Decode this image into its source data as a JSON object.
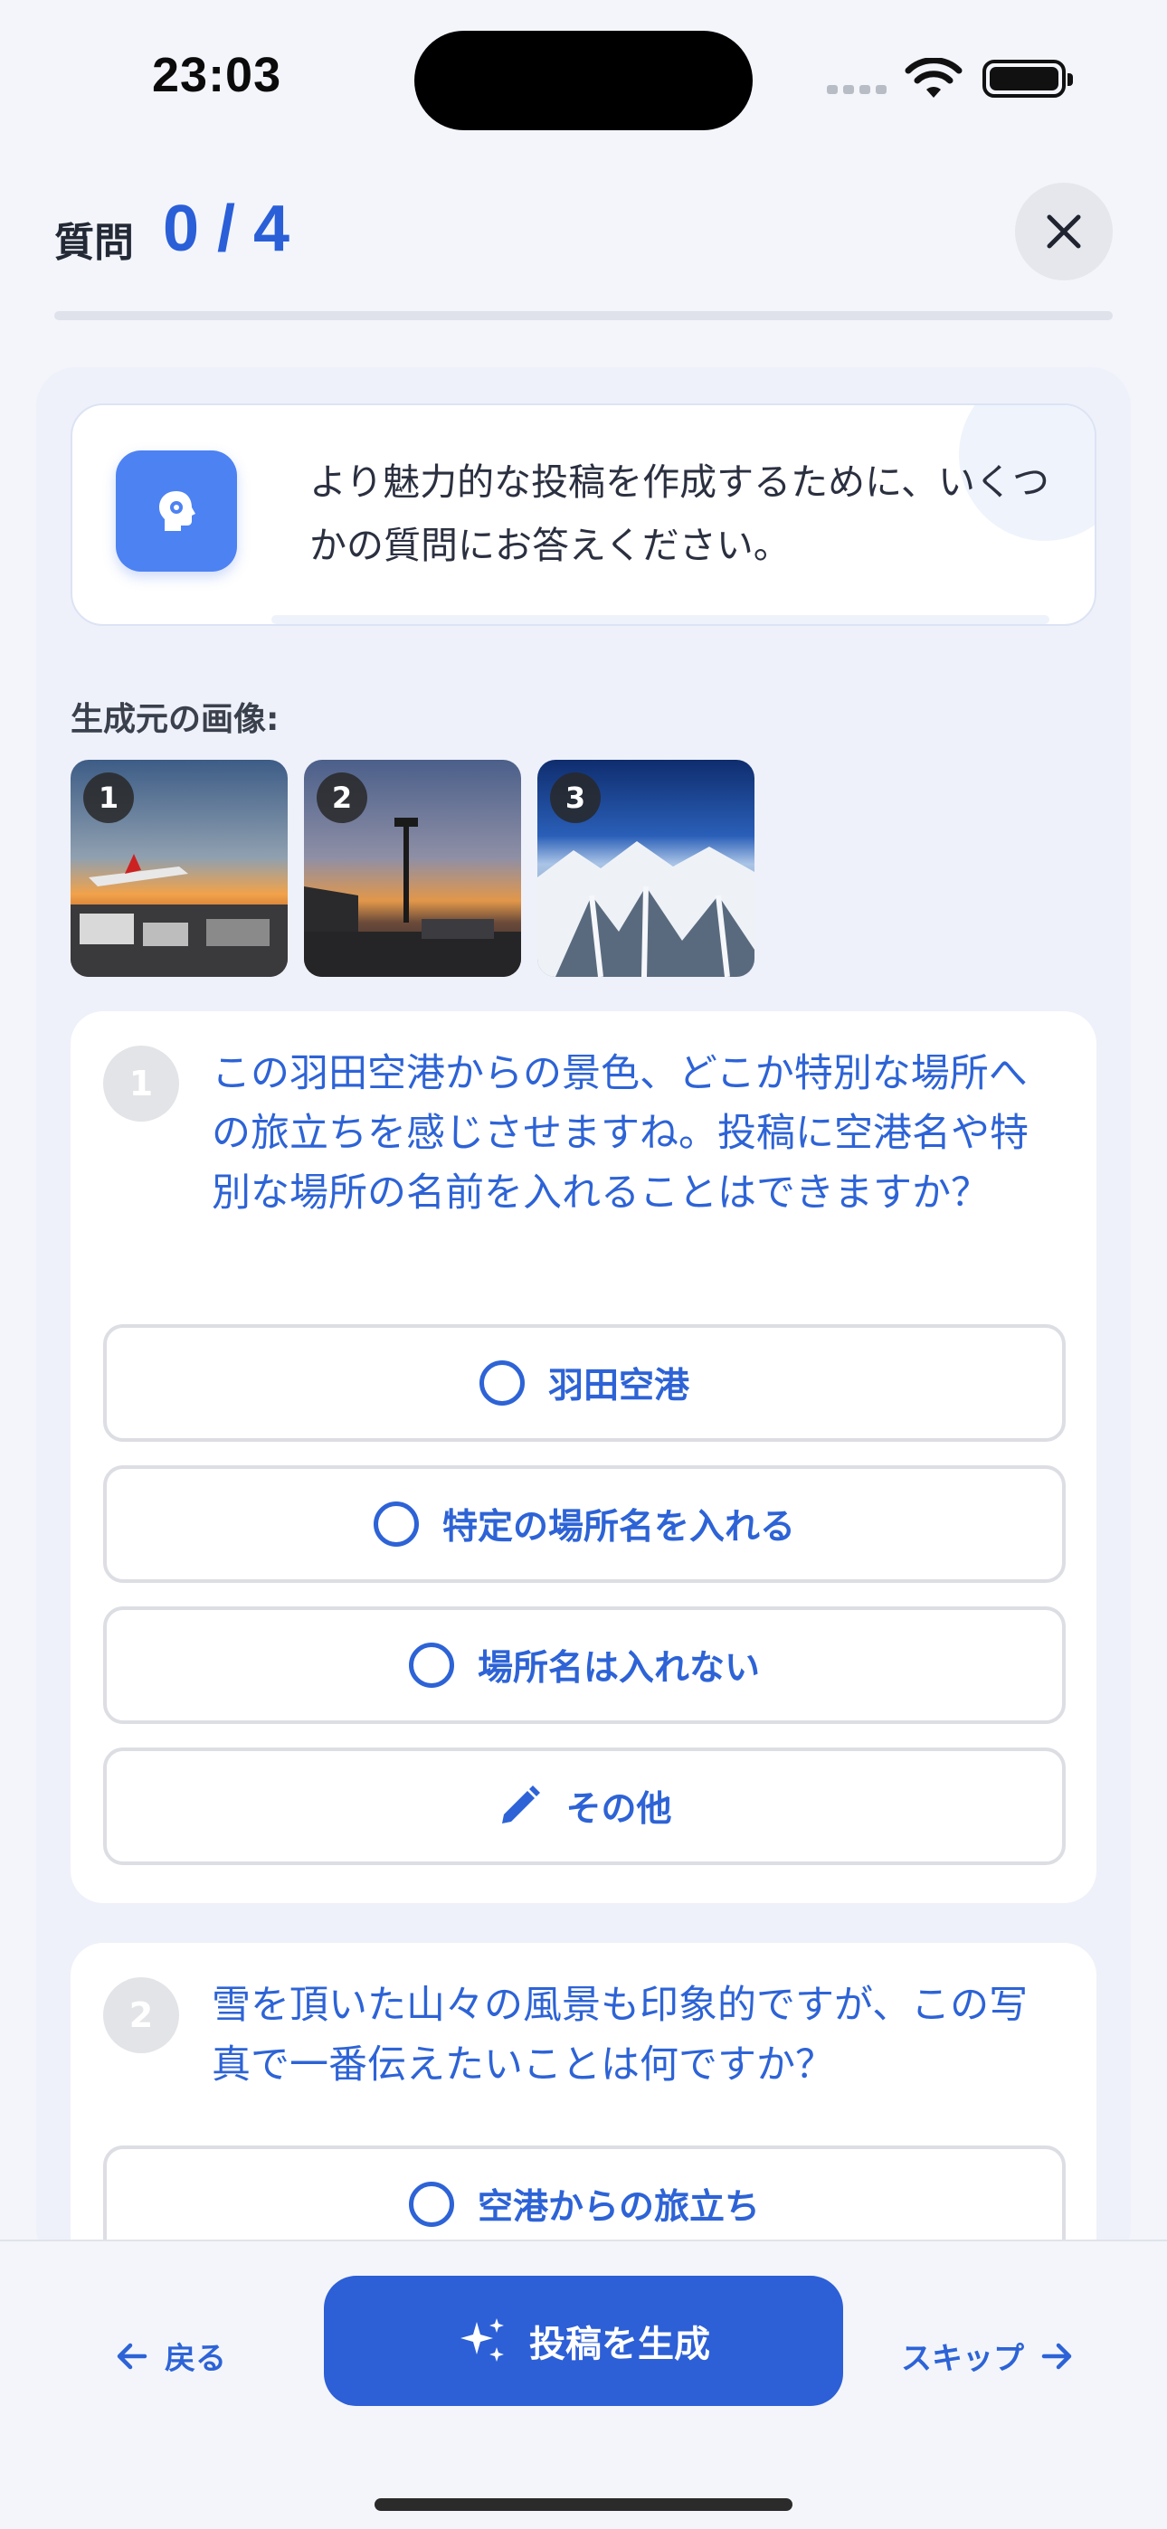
{
  "status_bar": {
    "time": "23:03"
  },
  "header": {
    "label": "質問",
    "progress": "0 / 4",
    "progress_fraction": 0.0
  },
  "intro": {
    "text": "より魅力的な投稿を作成するために、いくつかの質問にお答えください。",
    "icon": "head-gear-icon"
  },
  "source_images": {
    "label": "生成元の画像:",
    "items": [
      {
        "number": "1",
        "subject": "airport-sunset-plane"
      },
      {
        "number": "2",
        "subject": "airport-dusk-light-pole"
      },
      {
        "number": "3",
        "subject": "snowy-mountains-aerial"
      }
    ]
  },
  "questions": [
    {
      "number": "1",
      "text": "この羽田空港からの景色、どこか特別な場所への旅立ちを感じさせますね。投稿に空港名や特別な場所の名前を入れることはできますか？",
      "options": [
        {
          "label": "羽田空港",
          "icon": "radio-icon"
        },
        {
          "label": "特定の場所名を入れる",
          "icon": "radio-icon"
        },
        {
          "label": "場所名は入れない",
          "icon": "radio-icon"
        },
        {
          "label": "その他",
          "icon": "pencil-icon"
        }
      ]
    },
    {
      "number": "2",
      "text": "雪を頂いた山々の風景も印象的ですが、この写真で一番伝えたいことは何ですか？",
      "options": [
        {
          "label": "空港からの旅立ち",
          "icon": "radio-icon"
        }
      ]
    }
  ],
  "footer": {
    "back_label": "戻る",
    "generate_label": "投稿を生成",
    "skip_label": "スキップ"
  },
  "colors": {
    "accent": "#2d5fd6",
    "background": "#f3f5fb"
  }
}
